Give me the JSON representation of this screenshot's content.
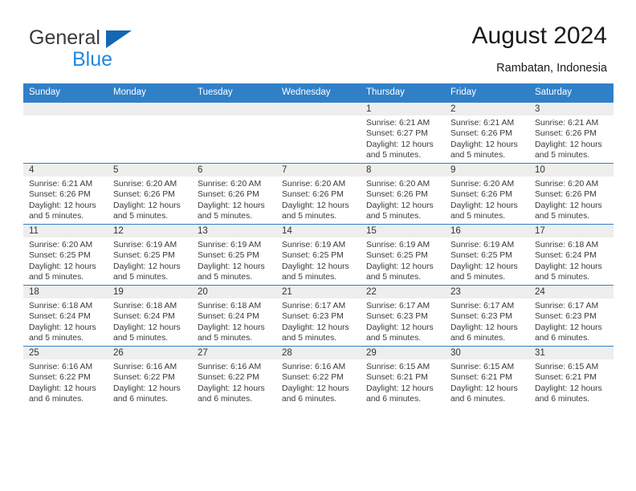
{
  "brand": {
    "name_part1": "General",
    "name_part2": "Blue",
    "triangle_color": "#1268b3",
    "blue_color": "#2288dd"
  },
  "header": {
    "title": "August 2024",
    "subtitle": "Rambatan, Indonesia",
    "header_bg": "#3080c8",
    "daynum_bg": "#eeeeee"
  },
  "weekday_headers": [
    "Sunday",
    "Monday",
    "Tuesday",
    "Wednesday",
    "Thursday",
    "Friday",
    "Saturday"
  ],
  "weeks": [
    [
      {
        "day": "",
        "sunrise": "",
        "sunset": "",
        "daylight1": "",
        "daylight2": ""
      },
      {
        "day": "",
        "sunrise": "",
        "sunset": "",
        "daylight1": "",
        "daylight2": ""
      },
      {
        "day": "",
        "sunrise": "",
        "sunset": "",
        "daylight1": "",
        "daylight2": ""
      },
      {
        "day": "",
        "sunrise": "",
        "sunset": "",
        "daylight1": "",
        "daylight2": ""
      },
      {
        "day": "1",
        "sunrise": "Sunrise: 6:21 AM",
        "sunset": "Sunset: 6:27 PM",
        "daylight1": "Daylight: 12 hours",
        "daylight2": "and 5 minutes."
      },
      {
        "day": "2",
        "sunrise": "Sunrise: 6:21 AM",
        "sunset": "Sunset: 6:26 PM",
        "daylight1": "Daylight: 12 hours",
        "daylight2": "and 5 minutes."
      },
      {
        "day": "3",
        "sunrise": "Sunrise: 6:21 AM",
        "sunset": "Sunset: 6:26 PM",
        "daylight1": "Daylight: 12 hours",
        "daylight2": "and 5 minutes."
      }
    ],
    [
      {
        "day": "4",
        "sunrise": "Sunrise: 6:21 AM",
        "sunset": "Sunset: 6:26 PM",
        "daylight1": "Daylight: 12 hours",
        "daylight2": "and 5 minutes."
      },
      {
        "day": "5",
        "sunrise": "Sunrise: 6:20 AM",
        "sunset": "Sunset: 6:26 PM",
        "daylight1": "Daylight: 12 hours",
        "daylight2": "and 5 minutes."
      },
      {
        "day": "6",
        "sunrise": "Sunrise: 6:20 AM",
        "sunset": "Sunset: 6:26 PM",
        "daylight1": "Daylight: 12 hours",
        "daylight2": "and 5 minutes."
      },
      {
        "day": "7",
        "sunrise": "Sunrise: 6:20 AM",
        "sunset": "Sunset: 6:26 PM",
        "daylight1": "Daylight: 12 hours",
        "daylight2": "and 5 minutes."
      },
      {
        "day": "8",
        "sunrise": "Sunrise: 6:20 AM",
        "sunset": "Sunset: 6:26 PM",
        "daylight1": "Daylight: 12 hours",
        "daylight2": "and 5 minutes."
      },
      {
        "day": "9",
        "sunrise": "Sunrise: 6:20 AM",
        "sunset": "Sunset: 6:26 PM",
        "daylight1": "Daylight: 12 hours",
        "daylight2": "and 5 minutes."
      },
      {
        "day": "10",
        "sunrise": "Sunrise: 6:20 AM",
        "sunset": "Sunset: 6:26 PM",
        "daylight1": "Daylight: 12 hours",
        "daylight2": "and 5 minutes."
      }
    ],
    [
      {
        "day": "11",
        "sunrise": "Sunrise: 6:20 AM",
        "sunset": "Sunset: 6:25 PM",
        "daylight1": "Daylight: 12 hours",
        "daylight2": "and 5 minutes."
      },
      {
        "day": "12",
        "sunrise": "Sunrise: 6:19 AM",
        "sunset": "Sunset: 6:25 PM",
        "daylight1": "Daylight: 12 hours",
        "daylight2": "and 5 minutes."
      },
      {
        "day": "13",
        "sunrise": "Sunrise: 6:19 AM",
        "sunset": "Sunset: 6:25 PM",
        "daylight1": "Daylight: 12 hours",
        "daylight2": "and 5 minutes."
      },
      {
        "day": "14",
        "sunrise": "Sunrise: 6:19 AM",
        "sunset": "Sunset: 6:25 PM",
        "daylight1": "Daylight: 12 hours",
        "daylight2": "and 5 minutes."
      },
      {
        "day": "15",
        "sunrise": "Sunrise: 6:19 AM",
        "sunset": "Sunset: 6:25 PM",
        "daylight1": "Daylight: 12 hours",
        "daylight2": "and 5 minutes."
      },
      {
        "day": "16",
        "sunrise": "Sunrise: 6:19 AM",
        "sunset": "Sunset: 6:25 PM",
        "daylight1": "Daylight: 12 hours",
        "daylight2": "and 5 minutes."
      },
      {
        "day": "17",
        "sunrise": "Sunrise: 6:18 AM",
        "sunset": "Sunset: 6:24 PM",
        "daylight1": "Daylight: 12 hours",
        "daylight2": "and 5 minutes."
      }
    ],
    [
      {
        "day": "18",
        "sunrise": "Sunrise: 6:18 AM",
        "sunset": "Sunset: 6:24 PM",
        "daylight1": "Daylight: 12 hours",
        "daylight2": "and 5 minutes."
      },
      {
        "day": "19",
        "sunrise": "Sunrise: 6:18 AM",
        "sunset": "Sunset: 6:24 PM",
        "daylight1": "Daylight: 12 hours",
        "daylight2": "and 5 minutes."
      },
      {
        "day": "20",
        "sunrise": "Sunrise: 6:18 AM",
        "sunset": "Sunset: 6:24 PM",
        "daylight1": "Daylight: 12 hours",
        "daylight2": "and 5 minutes."
      },
      {
        "day": "21",
        "sunrise": "Sunrise: 6:17 AM",
        "sunset": "Sunset: 6:23 PM",
        "daylight1": "Daylight: 12 hours",
        "daylight2": "and 5 minutes."
      },
      {
        "day": "22",
        "sunrise": "Sunrise: 6:17 AM",
        "sunset": "Sunset: 6:23 PM",
        "daylight1": "Daylight: 12 hours",
        "daylight2": "and 5 minutes."
      },
      {
        "day": "23",
        "sunrise": "Sunrise: 6:17 AM",
        "sunset": "Sunset: 6:23 PM",
        "daylight1": "Daylight: 12 hours",
        "daylight2": "and 6 minutes."
      },
      {
        "day": "24",
        "sunrise": "Sunrise: 6:17 AM",
        "sunset": "Sunset: 6:23 PM",
        "daylight1": "Daylight: 12 hours",
        "daylight2": "and 6 minutes."
      }
    ],
    [
      {
        "day": "25",
        "sunrise": "Sunrise: 6:16 AM",
        "sunset": "Sunset: 6:22 PM",
        "daylight1": "Daylight: 12 hours",
        "daylight2": "and 6 minutes."
      },
      {
        "day": "26",
        "sunrise": "Sunrise: 6:16 AM",
        "sunset": "Sunset: 6:22 PM",
        "daylight1": "Daylight: 12 hours",
        "daylight2": "and 6 minutes."
      },
      {
        "day": "27",
        "sunrise": "Sunrise: 6:16 AM",
        "sunset": "Sunset: 6:22 PM",
        "daylight1": "Daylight: 12 hours",
        "daylight2": "and 6 minutes."
      },
      {
        "day": "28",
        "sunrise": "Sunrise: 6:16 AM",
        "sunset": "Sunset: 6:22 PM",
        "daylight1": "Daylight: 12 hours",
        "daylight2": "and 6 minutes."
      },
      {
        "day": "29",
        "sunrise": "Sunrise: 6:15 AM",
        "sunset": "Sunset: 6:21 PM",
        "daylight1": "Daylight: 12 hours",
        "daylight2": "and 6 minutes."
      },
      {
        "day": "30",
        "sunrise": "Sunrise: 6:15 AM",
        "sunset": "Sunset: 6:21 PM",
        "daylight1": "Daylight: 12 hours",
        "daylight2": "and 6 minutes."
      },
      {
        "day": "31",
        "sunrise": "Sunrise: 6:15 AM",
        "sunset": "Sunset: 6:21 PM",
        "daylight1": "Daylight: 12 hours",
        "daylight2": "and 6 minutes."
      }
    ]
  ]
}
